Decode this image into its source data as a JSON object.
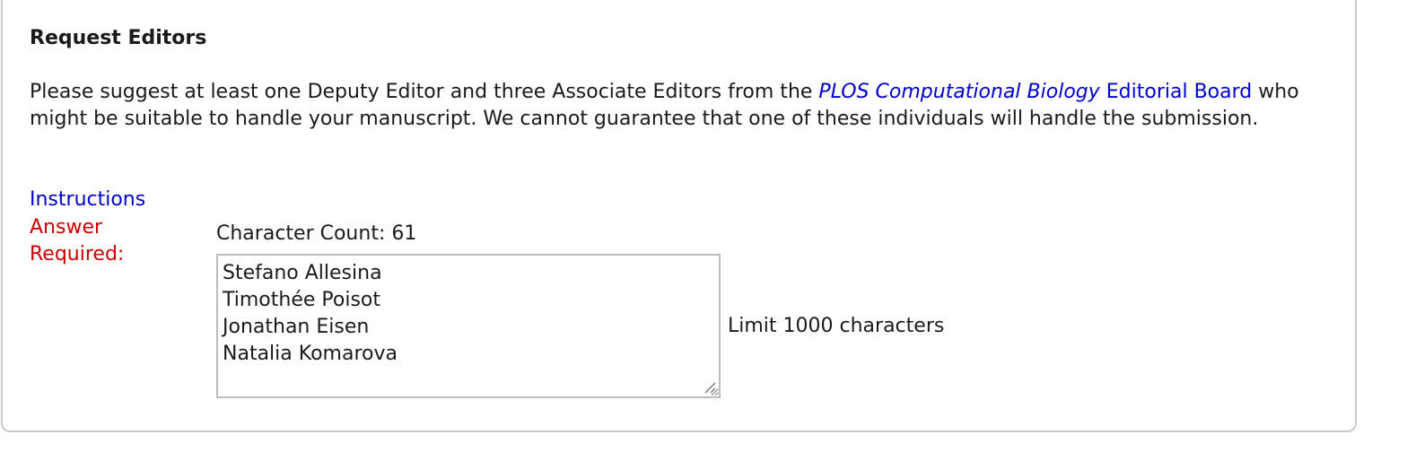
{
  "section": {
    "title": "Request Editors",
    "description_prefix": "Please suggest at least one Deputy Editor and three Associate Editors from the ",
    "board_link_journal": "PLOS Computational Biology",
    "board_link_rest": " Editorial Board",
    "description_suffix": " who might be suitable to handle your manuscript. We cannot guarantee that one of these individuals will handle the submission."
  },
  "form": {
    "instructions_label": "Instructions",
    "required_label": "Answer Required:",
    "character_count_text": "Character Count: 61",
    "answer_value": "Stefano Allesina\nTimothée Poisot\nJonathan Eisen\nNatalia Komarova",
    "limit_text": "Limit 1000 characters"
  },
  "colors": {
    "link": "#0000cc",
    "required": "#cc0000",
    "text": "#1a1a1a",
    "border": "#c8c8c8"
  }
}
